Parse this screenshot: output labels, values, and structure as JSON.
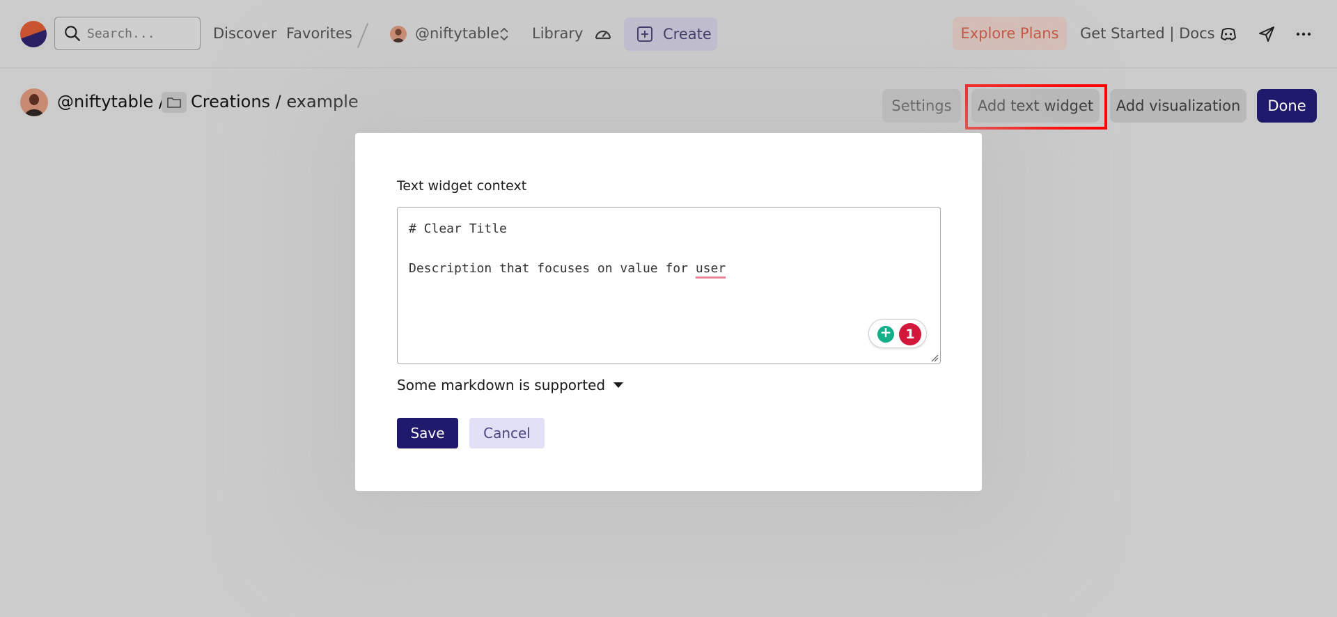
{
  "nav": {
    "search_placeholder": "Search...",
    "discover": "Discover",
    "favorites": "Favorites",
    "account": "@niftytable",
    "library": "Library",
    "create": "Create",
    "explore_plans": "Explore Plans",
    "get_started_docs": "Get Started | Docs"
  },
  "breadcrumb": {
    "user": "@niftytable /",
    "path": "Creations / example"
  },
  "toolbar": {
    "settings": "Settings",
    "add_text_widget": "Add text widget",
    "add_visualization": "Add visualization",
    "done": "Done"
  },
  "modal": {
    "label": "Text widget context",
    "text_line_1": "# Clear Title",
    "text_line_2_prefix": "Description that focuses on value for ",
    "text_line_2_flagged": "user",
    "grammar_issue_count": "1",
    "markdown_toggle": "Some markdown is supported",
    "save": "Save",
    "cancel": "Cancel"
  },
  "colors": {
    "primary": "#1f1a6b",
    "explore_text": "#c25642",
    "highlight": "#ff0000",
    "grammarly_green": "#15b08a",
    "grammarly_red": "#d1173a"
  }
}
